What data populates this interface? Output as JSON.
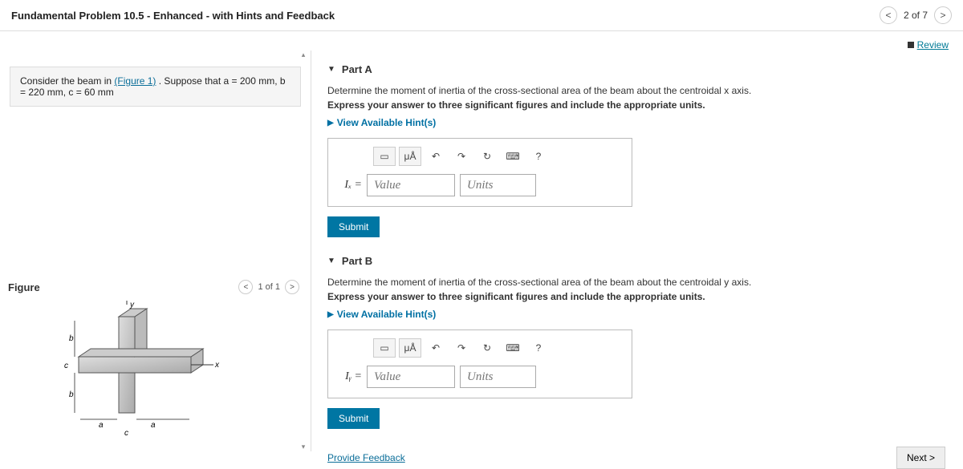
{
  "header": {
    "title": "Fundamental Problem 10.5 - Enhanced - with Hints and Feedback",
    "prev": "<",
    "counter": "2 of 7",
    "next": ">"
  },
  "review": {
    "label": "Review"
  },
  "problem": {
    "prefix": "Consider the beam in ",
    "figure_link": "(Figure 1)",
    "suffix": ". Suppose that a = 200 mm, b = 220 mm, c = 60 mm"
  },
  "figure": {
    "title": "Figure",
    "prev": "<",
    "counter": "1 of 1",
    "next": ">",
    "labels": {
      "y": "y",
      "x": "x",
      "b1": "b",
      "b2": "b",
      "c1": "c",
      "c2": "c",
      "a1": "a",
      "a2": "a"
    }
  },
  "partA": {
    "caret": "▼",
    "title": "Part A",
    "instr1": "Determine the moment of inertia of the cross-sectional area of the beam about the centroidal x axis.",
    "instr2": "Express your answer to three significant figures and include the appropriate units.",
    "hints": "View Available Hint(s)",
    "var": "Iₓ =",
    "value_ph": "Value",
    "units_ph": "Units",
    "submit": "Submit",
    "tb": {
      "t1": "▭",
      "t2": "μÅ",
      "t3": "↶",
      "t4": "↷",
      "t5": "↻",
      "t6": "⌨",
      "t7": "?"
    }
  },
  "partB": {
    "caret": "▼",
    "title": "Part B",
    "instr1": "Determine the moment of inertia of the cross-sectional area of the beam about the centroidal y axis.",
    "instr2": "Express your answer to three significant figures and include the appropriate units.",
    "hints": "View Available Hint(s)",
    "var": "Iᵧ =",
    "value_ph": "Value",
    "units_ph": "Units",
    "submit": "Submit",
    "tb": {
      "t1": "▭",
      "t2": "μÅ",
      "t3": "↶",
      "t4": "↷",
      "t5": "↻",
      "t6": "⌨",
      "t7": "?"
    }
  },
  "footer": {
    "feedback": "Provide Feedback",
    "next": "Next >"
  }
}
